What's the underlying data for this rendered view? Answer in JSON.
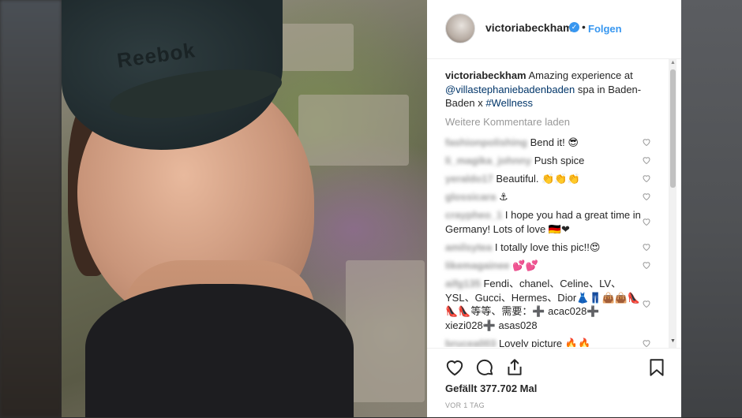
{
  "post": {
    "username": "victoriabeckham",
    "verified_mark": "✓",
    "separator": "•",
    "follow_label": "Folgen",
    "cap_logo": "Reebok"
  },
  "caption": {
    "username": "victoriabeckham",
    "text_1": " Amazing experience at ",
    "mention": "@villastephaniebadenbaden",
    "text_2": " spa in Baden-Baden x ",
    "hashtag": "#Wellness"
  },
  "load_more_label": "Weitere Kommentare laden",
  "comments": [
    {
      "user": "fashionpolishing",
      "text": "Bend it! 😎"
    },
    {
      "user": "li_magika_johnny",
      "text": "Push spice"
    },
    {
      "user": "yeraldo17",
      "text": "Beautiful. 👏👏👏"
    },
    {
      "user": "glossicara",
      "text": "⚓"
    },
    {
      "user": "craypheo_1",
      "text": "I hope you had a great time in Germany! Lots of love 🇩🇪❤"
    },
    {
      "user": "amilsytea",
      "text": "I totally love this pic!!😍"
    },
    {
      "user": "likemagainee",
      "text": "💕💕"
    },
    {
      "user": "aifg135",
      "text": "Fendi、chanel、Celine、LV、YSL、Gucci、Hermes、Dior👗👖👜👜👠👠👠等等、需要：➕ acac028➕ xiezi028➕ asas028"
    },
    {
      "user": "brucea003",
      "text": "Lovely picture 🔥🔥"
    }
  ],
  "likes_text": "Gefällt 377.702 Mal",
  "timestamp": "VOR 1 TAG",
  "icons": {
    "like": "heart-icon",
    "comment": "speech-bubble-icon",
    "share": "share-icon",
    "save": "bookmark-icon"
  },
  "colors": {
    "link_blue": "#3897f0",
    "text": "#262626",
    "muted": "#999999"
  }
}
